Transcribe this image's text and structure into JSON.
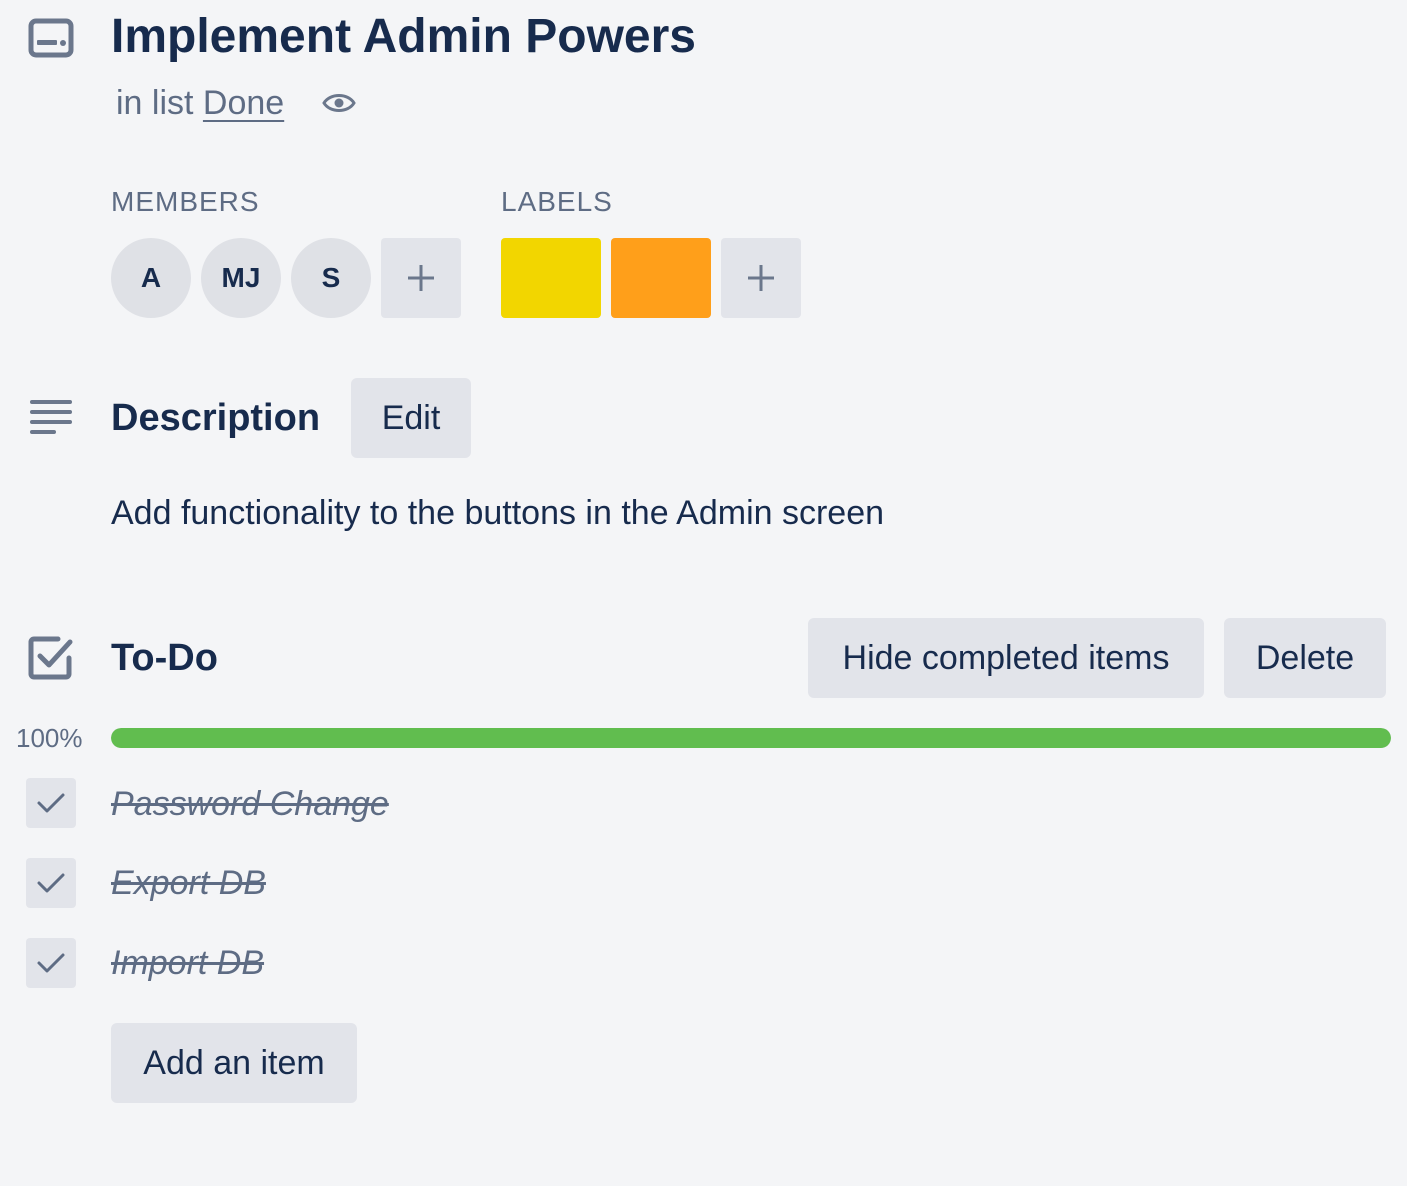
{
  "card": {
    "title": "Implement Admin Powers",
    "in_list_prefix": "in list",
    "list_name": "Done"
  },
  "members": {
    "heading": "MEMBERS",
    "items": [
      "A",
      "MJ",
      "S"
    ],
    "add_icon": "plus-icon"
  },
  "labels": {
    "heading": "LABELS",
    "colors": [
      "#f2d600",
      "#ff9f1a"
    ],
    "add_icon": "plus-icon"
  },
  "description": {
    "heading": "Description",
    "edit_label": "Edit",
    "text": "Add functionality to the buttons in the Admin screen"
  },
  "checklist": {
    "heading": "To-Do",
    "hide_label": "Hide completed items",
    "delete_label": "Delete",
    "percent_text": "100%",
    "progress": 1.0,
    "progress_color": "#61bd4f",
    "items": [
      {
        "text": "Password Change",
        "checked": true
      },
      {
        "text": "Export DB",
        "checked": true
      },
      {
        "text": "Import DB",
        "checked": true
      }
    ],
    "add_item_label": "Add an item"
  },
  "icons": {
    "card": "card-icon",
    "watch": "eye-icon",
    "description": "description-lines-icon",
    "checklist": "checklist-icon",
    "check": "check-icon"
  }
}
